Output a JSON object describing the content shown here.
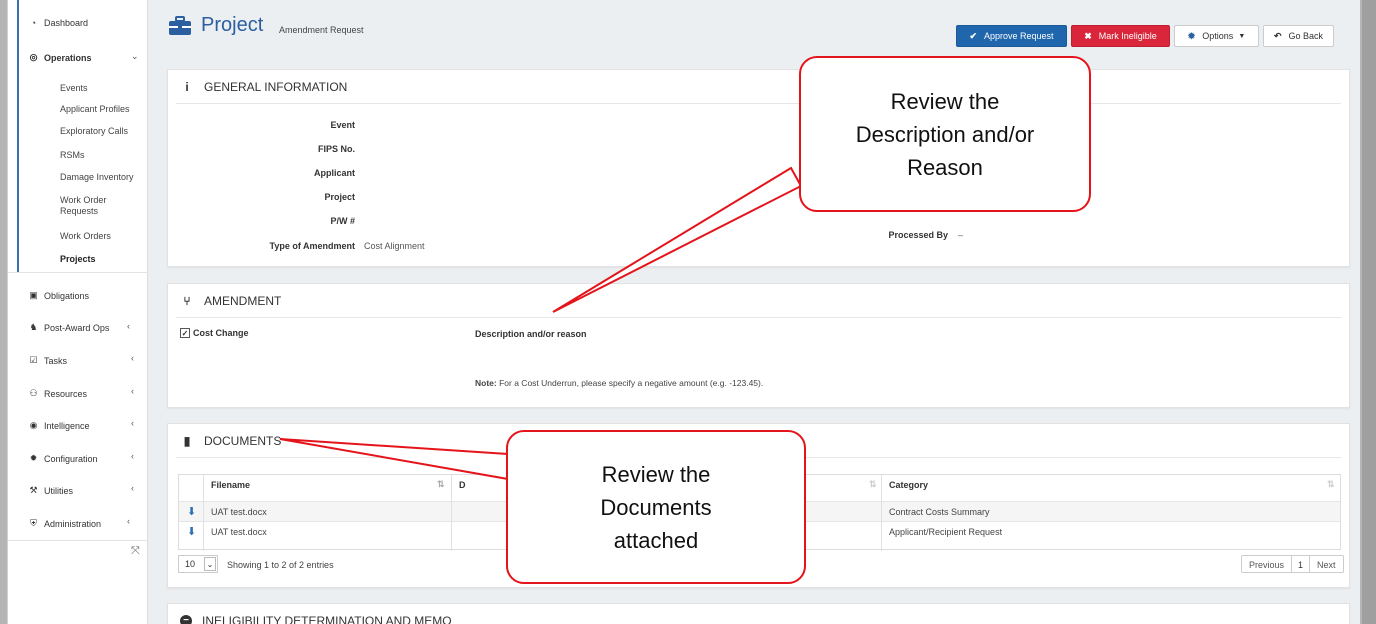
{
  "header": {
    "title": "Project",
    "subtitle": "Amendment Request",
    "buttons": {
      "approve": "Approve Request",
      "ineligible": "Mark Ineligible",
      "options": "Options",
      "goback": "Go Back"
    }
  },
  "sidebar": {
    "dashboard": "Dashboard",
    "operations": "Operations",
    "operations_items": [
      "Events",
      "Applicant Profiles",
      "Exploratory Calls",
      "RSMs",
      "Damage Inventory",
      "Work Order",
      "Requests",
      "Work Orders",
      "Projects"
    ],
    "obligations": "Obligations",
    "post_award": "Post-Award Ops",
    "tasks": "Tasks",
    "resources": "Resources",
    "intelligence": "Intelligence",
    "configuration": "Configuration",
    "utilities": "Utilities",
    "administration": "Administration"
  },
  "general": {
    "heading": "GENERAL INFORMATION",
    "labels": [
      "Event",
      "FIPS No.",
      "Applicant",
      "Project",
      "P/W #",
      "Type of Amendment"
    ],
    "type_value": "Cost Alignment",
    "processed_label": "Processed By",
    "processed_value": "–"
  },
  "amendment": {
    "heading": "AMENDMENT",
    "cost_change": "Cost Change",
    "desc_label": "Description and/or reason",
    "note_bold": "Note:",
    "note_text": "For a Cost Underrun, please specify a negative amount (e.g. -123.45)."
  },
  "documents": {
    "heading": "DOCUMENTS",
    "columns": [
      "Filename",
      "D",
      "Category"
    ],
    "rows": [
      {
        "filename": "UAT test.docx",
        "category": "Contract Costs Summary"
      },
      {
        "filename": "UAT test.docx",
        "category": "Applicant/Recipient Request"
      }
    ],
    "page_size": "10",
    "showing": "Showing 1 to 2 of 2 entries",
    "prev": "Previous",
    "page": "1",
    "next": "Next"
  },
  "ineligibility": {
    "heading": "INELIGIBILITY DETERMINATION AND MEMO"
  },
  "callouts": {
    "description_line1": "Review the",
    "description_line2": "Description and/or",
    "description_line3": "Reason",
    "documents_line1": "Review the",
    "documents_line2": "Documents",
    "documents_line3": "attached"
  },
  "colors": {
    "primary": "#1f66ad",
    "danger": "#d9263a",
    "callout_border": "#e4141b"
  }
}
